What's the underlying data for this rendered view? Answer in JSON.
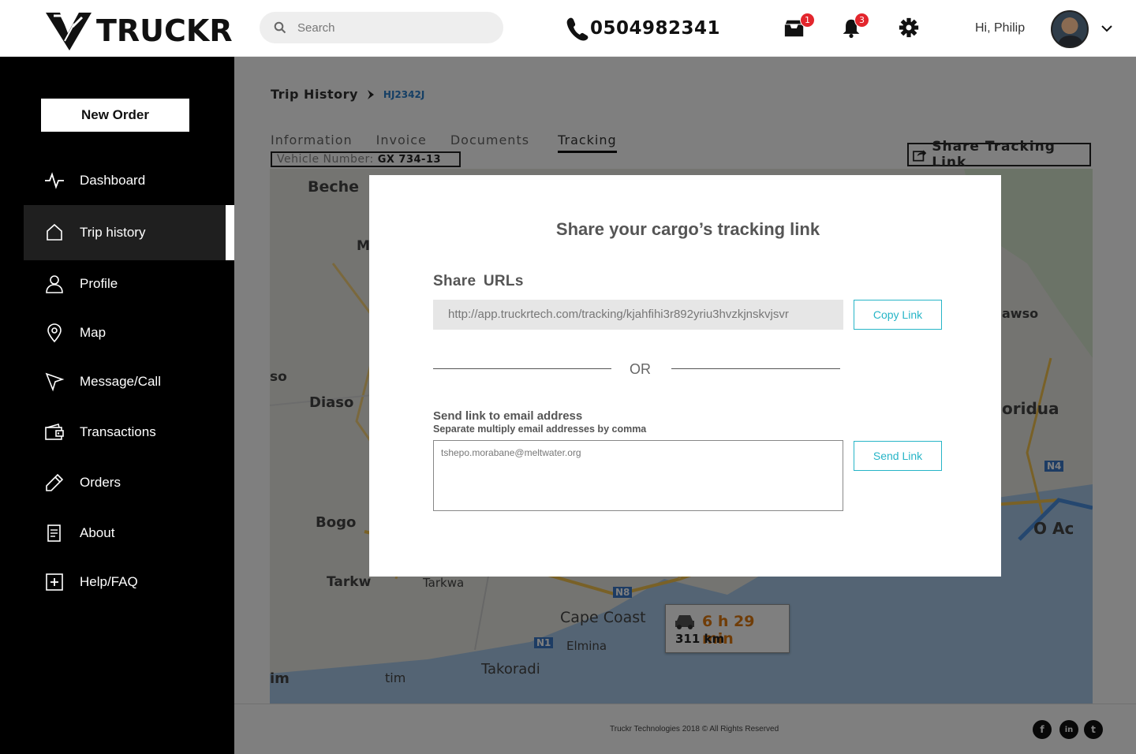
{
  "header": {
    "logo_text": "TRUCKR",
    "search_placeholder": "Search",
    "phone": "0504982341",
    "messages_badge": "1",
    "notifications_badge": "3",
    "greeting": "Hi, Philip"
  },
  "sidebar": {
    "new_order_label": "New Order",
    "items": [
      {
        "label": "Dashboard"
      },
      {
        "label": "Trip history"
      },
      {
        "label": "Profile"
      },
      {
        "label": "Map"
      },
      {
        "label": "Message/Call"
      },
      {
        "label": "Transactions"
      },
      {
        "label": "Orders"
      },
      {
        "label": "About"
      },
      {
        "label": "Help/FAQ"
      }
    ],
    "active_index": 1
  },
  "main": {
    "breadcrumb": {
      "root": "Trip History",
      "current": "HJ2342J"
    },
    "tabs": [
      {
        "label": "Information"
      },
      {
        "label": "Invoice"
      },
      {
        "label": "Documents"
      },
      {
        "label": "Tracking"
      }
    ],
    "active_tab": 3,
    "vehicle_label": "Vehicle Number:",
    "vehicle_number": "GX 734-13",
    "share_tracking_label": "Share Tracking Link",
    "map": {
      "labels": [
        "Beche",
        "M",
        "so",
        "Diaso",
        "Bogo",
        "Tarkw",
        "Tarkwa",
        "Cape Coast",
        "Elmina",
        "Takoradi",
        "im",
        "tim",
        "awso",
        "oridua",
        "O Ac"
      ],
      "road_markers": [
        "N8",
        "N1",
        "N4"
      ],
      "eta_time": "6 h 29 min",
      "eta_distance": "311 km"
    },
    "footer_text": "Truckr Technologies 2018 © All Rights Reserved",
    "social": [
      {
        "icon": "facebook-icon",
        "glyph": "f"
      },
      {
        "icon": "linkedin-icon",
        "glyph": "in"
      },
      {
        "icon": "twitter-icon",
        "glyph": "t"
      }
    ]
  },
  "modal": {
    "title": "Share your cargo’s tracking link",
    "share_urls_label": "Share  URLs",
    "url": "http://app.truckrtech.com/tracking/kjahfihi3r892yriu3hvzkjnskvjsvr",
    "copy_link_label": "Copy Link",
    "or_label": "OR",
    "email_label": "Send link to email address",
    "email_hint": "Separate multiply email addresses by comma",
    "email_value": "tshepo.morabane@meltwater.org",
    "send_link_label": "Send Link"
  },
  "colors": {
    "accent": "#27b5c7",
    "badge": "#e3262d",
    "sidebar_bg": "#000000",
    "eta": "#e07a10",
    "breadcrumb_link": "#2a7ecb"
  }
}
